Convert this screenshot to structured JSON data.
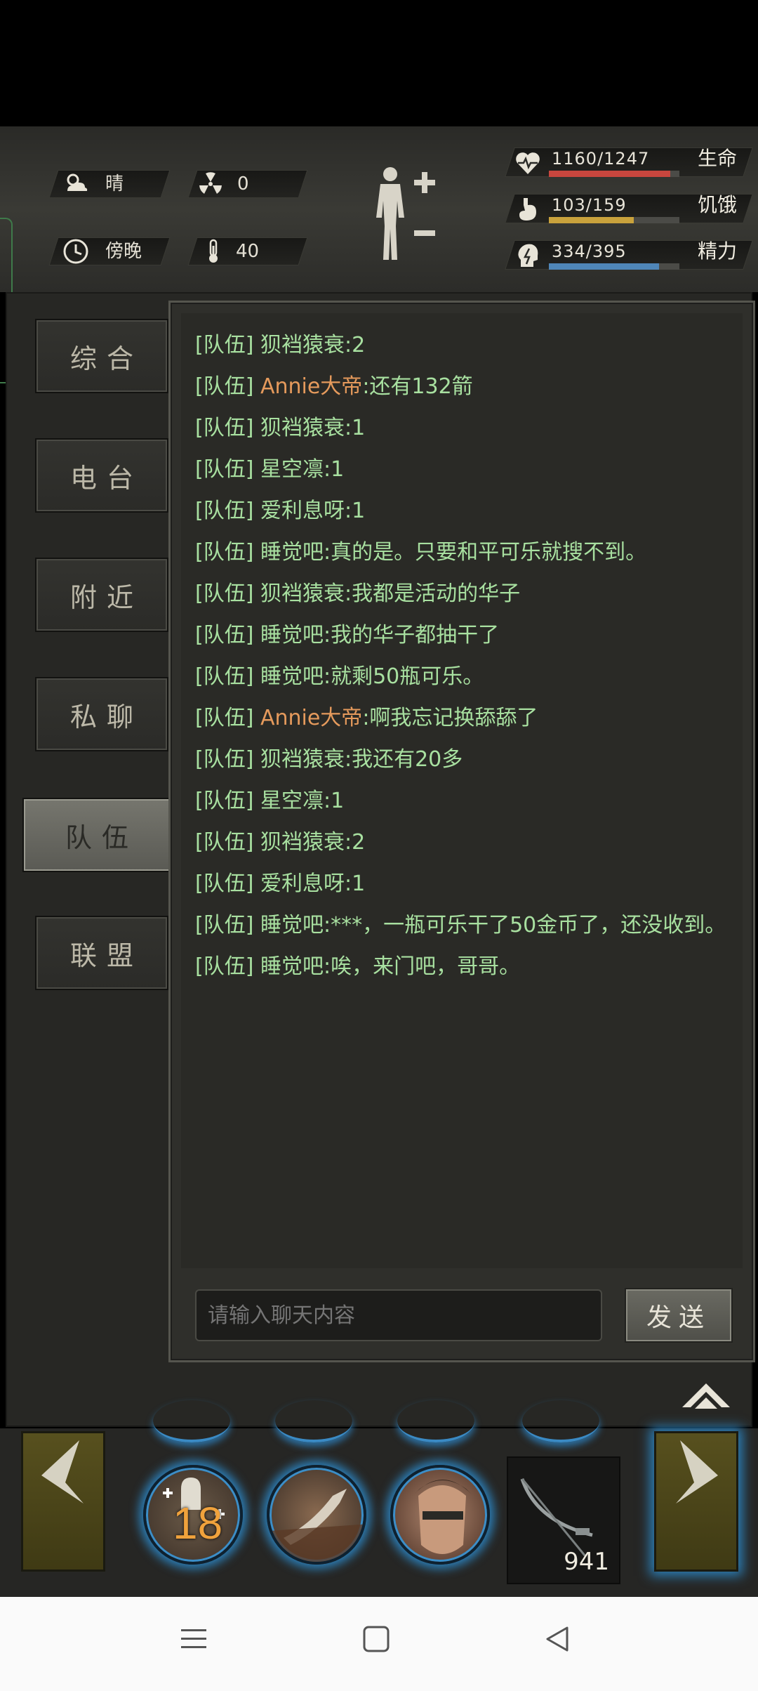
{
  "status": {
    "weather": {
      "icon": "sun-cloud-icon",
      "label": "晴"
    },
    "radiation": {
      "icon": "radiation-icon",
      "value": "0"
    },
    "time_of_day": {
      "icon": "clock-icon",
      "label": "傍晚"
    },
    "temperature": {
      "icon": "thermometer-icon",
      "value": "40"
    },
    "body_icon": "human-body-icon",
    "stats": [
      {
        "key": "health",
        "icon": "heart-pulse-icon",
        "value_text": "1160/1247",
        "label": "生命",
        "fraction": 0.93,
        "color": "#c8463e"
      },
      {
        "key": "hunger",
        "icon": "stomach-icon",
        "value_text": "103/159",
        "label": "饥饿",
        "fraction": 0.648,
        "color": "#c9a23c"
      },
      {
        "key": "energy",
        "icon": "energy-head-icon",
        "value_text": "334/395",
        "label": "精力",
        "fraction": 0.846,
        "color": "#4f86b8"
      }
    ]
  },
  "tabs": [
    {
      "label": "综合",
      "active": false
    },
    {
      "label": "电台",
      "active": false
    },
    {
      "label": "附近",
      "active": false
    },
    {
      "label": "私聊",
      "active": false
    },
    {
      "label": "队伍",
      "active": true
    },
    {
      "label": "联盟",
      "active": false
    }
  ],
  "chat": {
    "messages": [
      {
        "channel": "[队伍]",
        "sender": "狈裆猿衰",
        "text": ":2",
        "sender_color": "green"
      },
      {
        "channel": "[队伍]",
        "sender": "Annie大帝",
        "text": ":还有132箭",
        "sender_color": "orange"
      },
      {
        "channel": "[队伍]",
        "sender": "狈裆猿衰",
        "text": ":1",
        "sender_color": "green"
      },
      {
        "channel": "[队伍]",
        "sender": "星空凛",
        "text": ":1",
        "sender_color": "green"
      },
      {
        "channel": "[队伍]",
        "sender": "爱利息呀",
        "text": ":1",
        "sender_color": "green"
      },
      {
        "channel": "[队伍]",
        "sender": "睡觉吧",
        "text": ":真的是。只要和平可乐就搜不到。",
        "sender_color": "green"
      },
      {
        "channel": "[队伍]",
        "sender": "狈裆猿衰",
        "text": ":我都是活动的华子",
        "sender_color": "green"
      },
      {
        "channel": "[队伍]",
        "sender": "睡觉吧",
        "text": ":我的华子都抽干了",
        "sender_color": "green"
      },
      {
        "channel": "[队伍]",
        "sender": "睡觉吧",
        "text": ":就剩50瓶可乐。",
        "sender_color": "green"
      },
      {
        "channel": "[队伍]",
        "sender": "Annie大帝",
        "text": ":啊我忘记换舔舔了",
        "sender_color": "orange"
      },
      {
        "channel": "[队伍]",
        "sender": "狈裆猿衰",
        "text": ":我还有20多",
        "sender_color": "green"
      },
      {
        "channel": "[队伍]",
        "sender": "星空凛",
        "text": ":1",
        "sender_color": "green"
      },
      {
        "channel": "[队伍]",
        "sender": "狈裆猿衰",
        "text": ":2",
        "sender_color": "green"
      },
      {
        "channel": "[队伍]",
        "sender": "爱利息呀",
        "text": ":1",
        "sender_color": "green"
      },
      {
        "channel": "[队伍]",
        "sender": "睡觉吧",
        "text": ":***，一瓶可乐干了50金币了，还没收到。",
        "sender_color": "green"
      },
      {
        "channel": "[队伍]",
        "sender": "睡觉吧",
        "text": ":唉，来门吧，哥哥。",
        "sender_color": "green"
      }
    ],
    "input_placeholder": "请输入聊天内容",
    "send_label": "发送"
  },
  "gamebar": {
    "skill_badge": "18",
    "weapon_count": "941",
    "weapon_icon": "crossbow-icon"
  },
  "colors": {
    "green_text": "#a8e0a0",
    "orange_text": "#e59a5c",
    "skill_glow": "#2c7fb8"
  }
}
